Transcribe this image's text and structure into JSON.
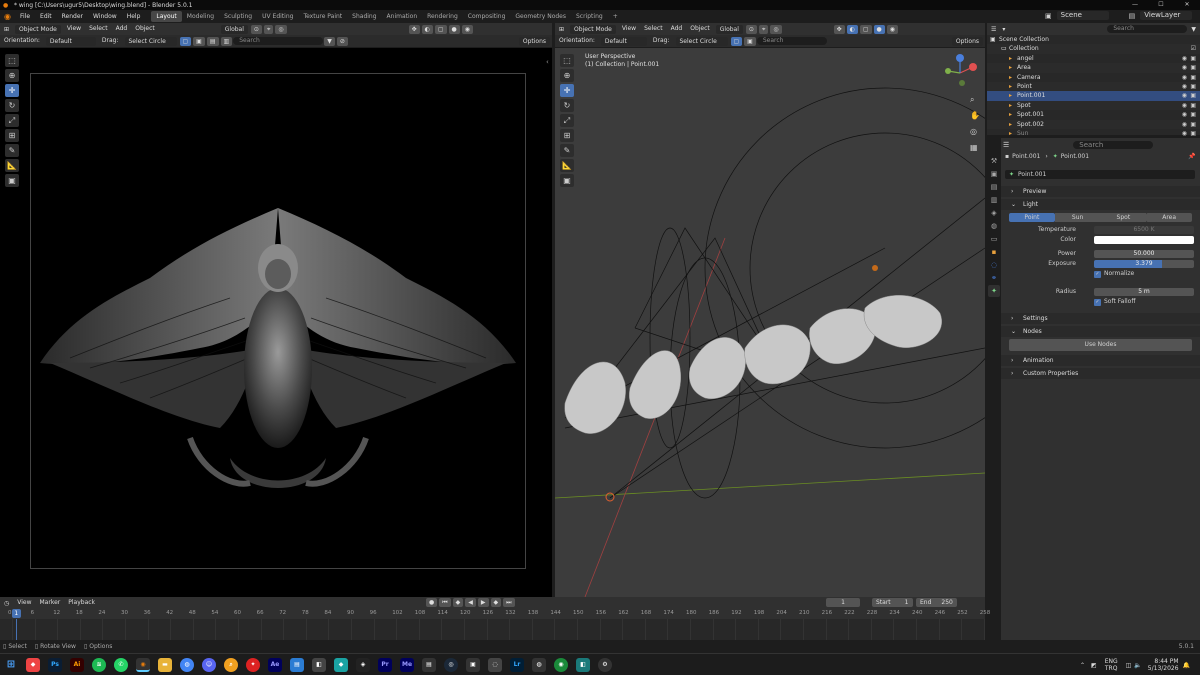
{
  "window": {
    "title": "* wing [C:\\Users\\ugur5\\Desktop\\wing.blend] - Blender 5.0.1",
    "controls": [
      "—",
      "☐",
      "✕"
    ]
  },
  "menubar": {
    "menus": [
      "File",
      "Edit",
      "Render",
      "Window",
      "Help"
    ],
    "workspaces": [
      "Layout",
      "Modeling",
      "Sculpting",
      "UV Editing",
      "Texture Paint",
      "Shading",
      "Animation",
      "Rendering",
      "Compositing",
      "Geometry Nodes",
      "Scripting"
    ],
    "active_workspace": "Layout",
    "scene": "Scene",
    "view_layer": "ViewLayer"
  },
  "left_view": {
    "mode": "Object Mode",
    "menus": [
      "View",
      "Select",
      "Add",
      "Object"
    ],
    "orientation_label": "Orientation:",
    "orientation": "Default",
    "drag_label": "Drag:",
    "drag": "Select Circle",
    "transform": "Global",
    "search_placeholder": "Search",
    "options": "Options"
  },
  "right_view": {
    "mode": "Object Mode",
    "menus": [
      "View",
      "Select",
      "Add",
      "Object"
    ],
    "orientation_label": "Orientation:",
    "orientation": "Default",
    "drag_label": "Drag:",
    "drag": "Select Circle",
    "transform": "Global",
    "search_placeholder": "Search",
    "options": "Options",
    "overlay_line1": "User Perspective",
    "overlay_line2": "(1) Collection | Point.001"
  },
  "outliner": {
    "root": "Scene Collection",
    "collection": "Collection",
    "search_placeholder": "Search",
    "items": [
      "angel",
      "Area",
      "Camera",
      "Point",
      "Point.001",
      "Spot",
      "Spot.001",
      "Spot.002",
      "Sun"
    ]
  },
  "properties": {
    "search_placeholder": "Search",
    "breadcrumb_obj": "Point.001",
    "breadcrumb_data": "Point.001",
    "datablock": "Point.001",
    "sections": {
      "preview": "Preview",
      "light": "Light",
      "settings": "Settings",
      "nodes": "Nodes",
      "animation": "Animation",
      "custom": "Custom Properties"
    },
    "light_types": [
      "Point",
      "Sun",
      "Spot",
      "Area"
    ],
    "active_light_type": "Point",
    "temperature_label": "Temperature",
    "temperature": "6500 K",
    "color_label": "Color",
    "color_value": "#ffffff",
    "power_label": "Power",
    "power": "50.000",
    "exposure_label": "Exposure",
    "exposure": "3.379",
    "normalize": "Normalize",
    "radius_label": "Radius",
    "radius": "5 m",
    "soft_falloff": "Soft Falloff",
    "use_nodes": "Use Nodes"
  },
  "timeline": {
    "menus": [
      "View",
      "Marker",
      "Playback"
    ],
    "current_frame": "1",
    "start_label": "Start",
    "start": "1",
    "end_label": "End",
    "end": "250",
    "ticks": [
      "0",
      "6",
      "12",
      "18",
      "24",
      "30",
      "36",
      "42",
      "48",
      "54",
      "60",
      "66",
      "72",
      "78",
      "84",
      "90",
      "96",
      "102",
      "108",
      "114",
      "120",
      "126",
      "132",
      "138",
      "144",
      "150",
      "156",
      "162",
      "168",
      "174",
      "180",
      "186",
      "192",
      "198",
      "204",
      "210",
      "216",
      "222",
      "228",
      "234",
      "240",
      "246",
      "252",
      "258"
    ],
    "playhead": "1"
  },
  "statusbar": {
    "items": [
      "Select",
      "Rotate View",
      "Options"
    ],
    "version": "5.0.1"
  },
  "taskbar": {
    "lang": "ENG",
    "region": "TRQ",
    "time": "8:44 PM",
    "date": "5/13/2026",
    "apps": [
      "Ps",
      "Ai",
      "Ae",
      "Pr",
      "Me",
      "Lr"
    ]
  },
  "colors": {
    "accent": "#4772b3",
    "bg_dark": "#1d1d1d",
    "header": "#303030",
    "viewport": "#3c3c3c",
    "light_green": "#7ed68a",
    "object_orange": "#e9a13d"
  }
}
